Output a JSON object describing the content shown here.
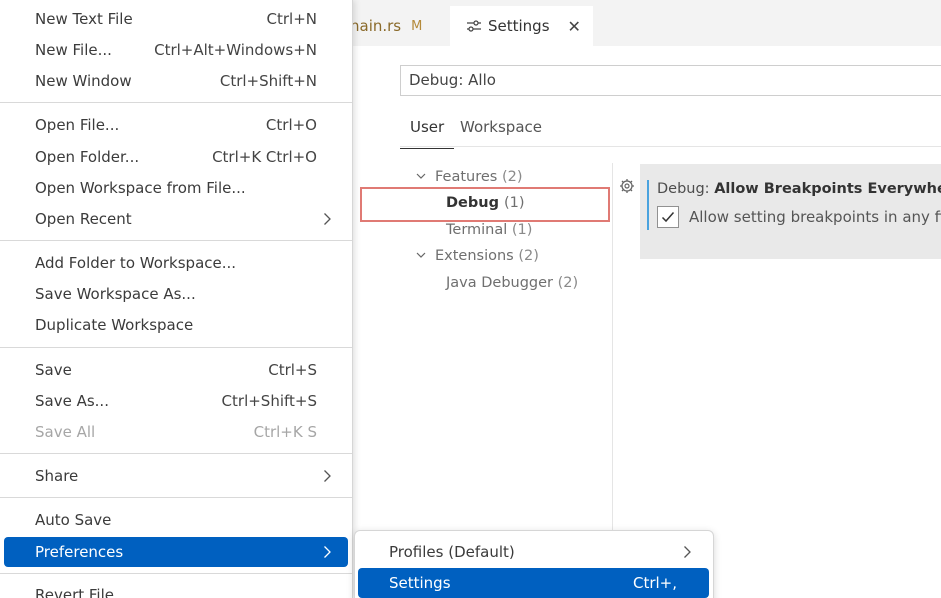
{
  "editor": {
    "tabs": {
      "main_rs": {
        "label": "main.rs",
        "visible_label": "nain.rs",
        "modified": "M"
      },
      "settings": {
        "label": "Settings",
        "close_glyph": "✕"
      }
    },
    "search": {
      "value": "Debug: Allo"
    },
    "scope_tabs": {
      "user": "User",
      "workspace": "Workspace"
    },
    "toc": {
      "features": {
        "label": "Features",
        "count": "(2)"
      },
      "debug": {
        "label": "Debug",
        "count": "(1)"
      },
      "terminal": {
        "label": "Terminal",
        "count": "(1)"
      },
      "extensions": {
        "label": "Extensions",
        "count": "(2)"
      },
      "java_debugger": {
        "label": "Java Debugger",
        "count": "(2)"
      }
    },
    "setting": {
      "category": "Debug: ",
      "name": "Allow Breakpoints Everywhere",
      "description": "Allow setting breakpoints in any file.",
      "checked": true
    }
  },
  "file_menu": {
    "new_text_file": {
      "label": "New Text File",
      "shortcut": "Ctrl+N"
    },
    "new_file": {
      "label": "New File...",
      "shortcut": "Ctrl+Alt+Windows+N"
    },
    "new_window": {
      "label": "New Window",
      "shortcut": "Ctrl+Shift+N"
    },
    "open_file": {
      "label": "Open File...",
      "shortcut": "Ctrl+O"
    },
    "open_folder": {
      "label": "Open Folder...",
      "shortcut": "Ctrl+K Ctrl+O"
    },
    "open_workspace": {
      "label": "Open Workspace from File..."
    },
    "open_recent": {
      "label": "Open Recent"
    },
    "add_folder": {
      "label": "Add Folder to Workspace..."
    },
    "save_workspace_as": {
      "label": "Save Workspace As..."
    },
    "duplicate_workspace": {
      "label": "Duplicate Workspace"
    },
    "save": {
      "label": "Save",
      "shortcut": "Ctrl+S"
    },
    "save_as": {
      "label": "Save As...",
      "shortcut": "Ctrl+Shift+S"
    },
    "save_all": {
      "label": "Save All",
      "shortcut": "Ctrl+K S"
    },
    "share": {
      "label": "Share"
    },
    "auto_save": {
      "label": "Auto Save"
    },
    "preferences": {
      "label": "Preferences"
    },
    "revert_file": {
      "label": "Revert File"
    }
  },
  "preferences_menu": {
    "profiles": {
      "label": "Profiles (Default)"
    },
    "settings": {
      "label": "Settings",
      "shortcut": "Ctrl+,"
    }
  },
  "colors": {
    "accent": "#0060c0",
    "highlight_box": "#e07a74",
    "modified": "#b48a3a",
    "setting_indicator": "#4aa3df"
  }
}
